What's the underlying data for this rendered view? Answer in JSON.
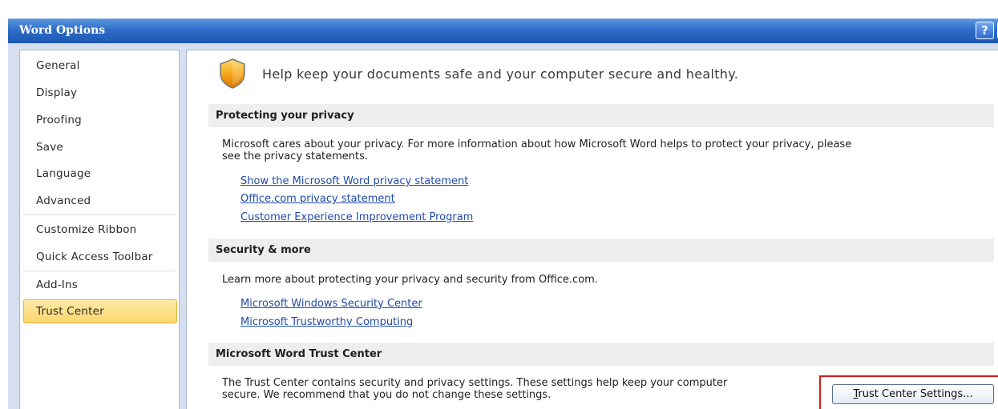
{
  "window": {
    "title": "Word Options",
    "help_button": "?"
  },
  "sidebar": {
    "items": [
      {
        "label": "General",
        "selected": false
      },
      {
        "label": "Display",
        "selected": false
      },
      {
        "label": "Proofing",
        "selected": false
      },
      {
        "label": "Save",
        "selected": false
      },
      {
        "label": "Language",
        "selected": false
      },
      {
        "label": "Advanced",
        "selected": false
      },
      {
        "label": "Customize Ribbon",
        "selected": false
      },
      {
        "label": "Quick Access Toolbar",
        "selected": false
      },
      {
        "label": "Add-Ins",
        "selected": false
      },
      {
        "label": "Trust Center",
        "selected": true
      }
    ]
  },
  "main": {
    "header_icon": "shield-icon",
    "header_text": "Help keep your documents safe and your computer secure and healthy.",
    "sections": {
      "privacy": {
        "title": "Protecting your privacy",
        "description_line1": "Microsoft cares about your privacy. For more information about how Microsoft Word helps to protect your privacy, please",
        "description_line2": "see the privacy statements.",
        "links": [
          "Show the Microsoft Word privacy statement",
          "Office.com privacy statement",
          "Customer Experience Improvement Program"
        ]
      },
      "security": {
        "title": "Security & more",
        "description": "Learn more about protecting your privacy and security from Office.com.",
        "links": [
          "Microsoft Windows Security Center",
          "Microsoft Trustworthy Computing"
        ]
      },
      "trust_center": {
        "title": "Microsoft Word Trust Center",
        "description_line1": "The Trust Center contains security and privacy settings. These settings help keep your computer",
        "description_line2": "secure. We recommend that you do not change these settings.",
        "button_mnemonic": "T",
        "button_rest": "rust Center Settings..."
      }
    }
  },
  "colors": {
    "titlebar": "#2d6dc8",
    "selected_item": "#fbd76c",
    "link": "#1f4aa8",
    "highlight_box": "#d21c1c"
  }
}
